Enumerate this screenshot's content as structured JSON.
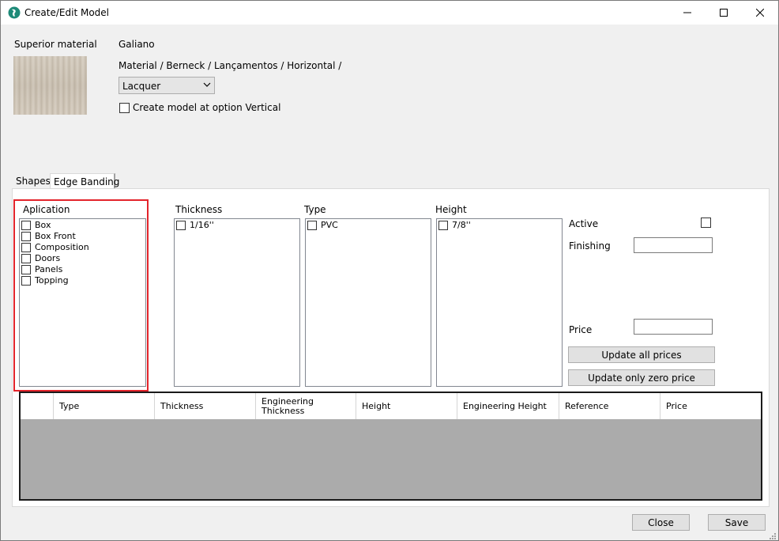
{
  "window": {
    "title": "Create/Edit Model"
  },
  "material": {
    "label": "Superior material",
    "name": "Galiano",
    "path": "Material / Berneck / Lançamentos / Horizontal /",
    "finish_selected": "Lacquer",
    "vertical_option_label": "Create model at option Vertical"
  },
  "tabs": [
    {
      "label": "Shapes"
    },
    {
      "label": "Edge Banding"
    }
  ],
  "aplication": {
    "label": "Aplication",
    "items": [
      "Box",
      "Box Front",
      "Composition",
      "Doors",
      "Panels",
      "Topping"
    ]
  },
  "thickness": {
    "label": "Thickness",
    "items": [
      "1/16''"
    ]
  },
  "type": {
    "label": "Type",
    "items": [
      "PVC"
    ]
  },
  "height": {
    "label": "Height",
    "items": [
      "7/8''"
    ]
  },
  "props": {
    "active_label": "Active",
    "finishing_label": "Finishing",
    "finishing_value": "",
    "price_label": "Price",
    "price_value": "",
    "update_all_label": "Update all prices",
    "update_zero_label": "Update only zero price"
  },
  "grid": {
    "columns": [
      "Type",
      "Thickness",
      "Engineering Thickness",
      "Height",
      "Engineering Height",
      "Reference",
      "Price"
    ]
  },
  "footer": {
    "close_label": "Close",
    "save_label": "Save"
  },
  "colors": {
    "highlight_border": "#e3242b",
    "grid_body": "#ababab"
  }
}
